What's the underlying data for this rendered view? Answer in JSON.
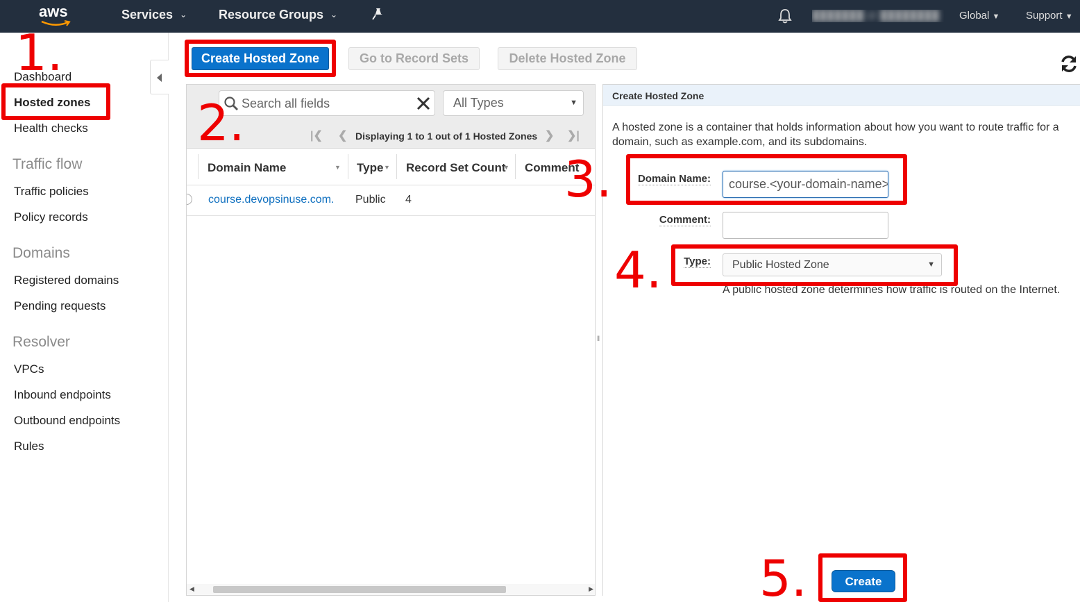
{
  "topnav": {
    "logo": "aws",
    "services": "Services",
    "resource_groups": "Resource Groups",
    "user": "███████ @ ████████",
    "region": "Global",
    "support": "Support"
  },
  "sidebar": {
    "items": [
      "Dashboard",
      "Hosted zones",
      "Health checks"
    ],
    "traffic_flow": {
      "title": "Traffic flow",
      "items": [
        "Traffic policies",
        "Policy records"
      ]
    },
    "domains": {
      "title": "Domains",
      "items": [
        "Registered domains",
        "Pending requests"
      ]
    },
    "resolver": {
      "title": "Resolver",
      "items": [
        "VPCs",
        "Inbound endpoints",
        "Outbound endpoints",
        "Rules"
      ]
    }
  },
  "toolbar": {
    "create": "Create Hosted Zone",
    "record_sets": "Go to Record Sets",
    "delete": "Delete Hosted Zone"
  },
  "list": {
    "search_placeholder": "Search all fields",
    "type_filter": "All Types",
    "pager_text": "Displaying 1 to 1 out of 1 Hosted Zones",
    "columns": [
      "Domain Name",
      "Type",
      "Record Set Count",
      "Comment"
    ],
    "rows": [
      {
        "domain": "course.devopsinuse.com.",
        "type": "Public",
        "count": "4",
        "comment": ""
      }
    ]
  },
  "form": {
    "title": "Create Hosted Zone",
    "description": "A hosted zone is a container that holds information about how you want to route traffic for a domain, such as example.com, and its subdomains.",
    "domain_label": "Domain Name:",
    "domain_value": "course.<your-domain-name>",
    "comment_label": "Comment:",
    "comment_value": "",
    "type_label": "Type:",
    "type_value": "Public Hosted Zone",
    "type_help": "A public hosted zone determines how traffic is routed on the Internet.",
    "submit": "Create"
  },
  "annotations": [
    "1.",
    "2.",
    "3.",
    "4.",
    "5."
  ],
  "colors": {
    "annotation": "#ee0000",
    "primary": "#0a73cc",
    "nav": "#232f3e"
  }
}
